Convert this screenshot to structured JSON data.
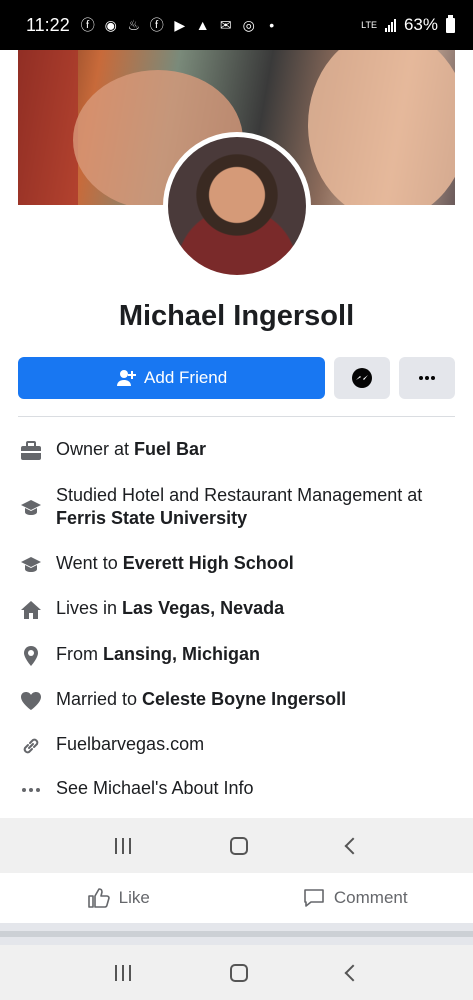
{
  "status_bar": {
    "time": "11:22",
    "network": "LTE",
    "battery": "63%"
  },
  "profile": {
    "name": "Michael Ingersoll"
  },
  "actions": {
    "add_friend_label": "Add Friend"
  },
  "info": [
    {
      "icon": "briefcase-icon",
      "prefix": "Owner at ",
      "bold": "Fuel Bar"
    },
    {
      "icon": "graduation-cap-icon",
      "prefix": "Studied Hotel and Restaurant Management at ",
      "bold": "Ferris State University"
    },
    {
      "icon": "graduation-cap-icon",
      "prefix": "Went to ",
      "bold": "Everett High School"
    },
    {
      "icon": "house-icon",
      "prefix": "Lives in ",
      "bold": "Las Vegas, Nevada"
    },
    {
      "icon": "location-pin-icon",
      "prefix": "From ",
      "bold": "Lansing, Michigan"
    },
    {
      "icon": "heart-icon",
      "prefix": "Married to ",
      "bold": "Celeste Boyne Ingersoll"
    },
    {
      "icon": "link-icon",
      "prefix": "Fuelbarvegas.com",
      "bold": ""
    },
    {
      "icon": "ellipsis-icon",
      "prefix": "See Michael's About Info",
      "bold": ""
    }
  ],
  "reactions": {
    "like_label": "Like",
    "comment_label": "Comment"
  },
  "colors": {
    "accent": "#1877f2",
    "icon_gray": "#65676b"
  }
}
